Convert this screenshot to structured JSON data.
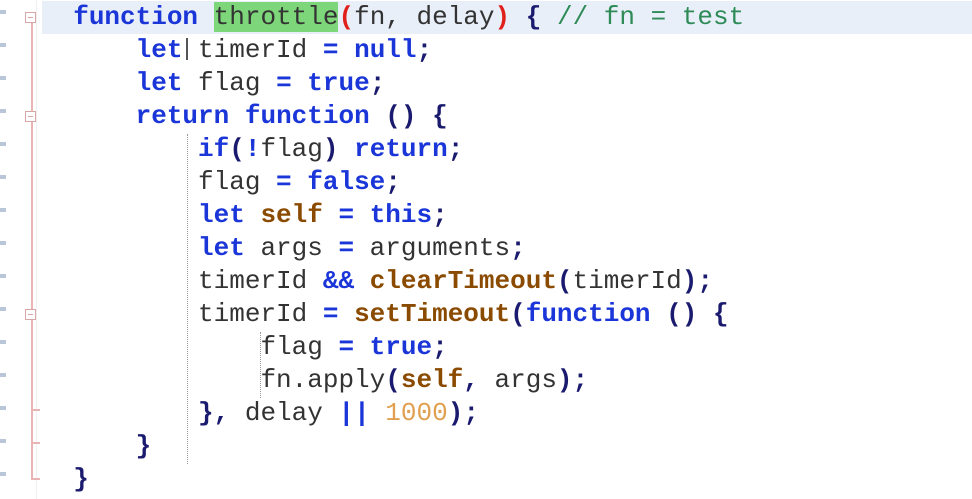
{
  "editor": {
    "lines": [
      {
        "tokens": [
          {
            "t": "function",
            "c": "kw"
          },
          {
            "t": " ",
            "c": "ident"
          },
          {
            "t": "throttle",
            "c": "hl-word"
          },
          {
            "t": "(",
            "c": "paren-hl"
          },
          {
            "t": "fn, delay",
            "c": "ident"
          },
          {
            "t": ")",
            "c": "paren-hl"
          },
          {
            "t": " ",
            "c": "ident"
          },
          {
            "t": "{",
            "c": "punc"
          },
          {
            "t": " // fn = test",
            "c": "comment"
          }
        ],
        "indent": "  ",
        "current": true
      },
      {
        "tokens": [
          {
            "t": "let",
            "c": "kw"
          },
          {
            "t": " timerId ",
            "c": "ident"
          },
          {
            "t": "=",
            "c": "op"
          },
          {
            "t": " ",
            "c": "ident"
          },
          {
            "t": "null",
            "c": "kw"
          },
          {
            "t": ";",
            "c": "punc"
          }
        ],
        "indent": "      "
      },
      {
        "tokens": [
          {
            "t": "let",
            "c": "kw"
          },
          {
            "t": " flag ",
            "c": "ident"
          },
          {
            "t": "=",
            "c": "op"
          },
          {
            "t": " ",
            "c": "ident"
          },
          {
            "t": "true",
            "c": "kw"
          },
          {
            "t": ";",
            "c": "punc"
          }
        ],
        "indent": "      "
      },
      {
        "tokens": [
          {
            "t": "return",
            "c": "kw"
          },
          {
            "t": " ",
            "c": "ident"
          },
          {
            "t": "function",
            "c": "kw"
          },
          {
            "t": " ",
            "c": "ident"
          },
          {
            "t": "()",
            "c": "punc"
          },
          {
            "t": " ",
            "c": "ident"
          },
          {
            "t": "{",
            "c": "punc"
          }
        ],
        "indent": "      "
      },
      {
        "tokens": [
          {
            "t": "if",
            "c": "kw"
          },
          {
            "t": "(",
            "c": "punc"
          },
          {
            "t": "!",
            "c": "op"
          },
          {
            "t": "flag",
            "c": "ident"
          },
          {
            "t": ")",
            "c": "punc"
          },
          {
            "t": " ",
            "c": "ident"
          },
          {
            "t": "return",
            "c": "kw"
          },
          {
            "t": ";",
            "c": "punc"
          }
        ],
        "indent": "          "
      },
      {
        "tokens": [
          {
            "t": "flag ",
            "c": "ident"
          },
          {
            "t": "=",
            "c": "op"
          },
          {
            "t": " ",
            "c": "ident"
          },
          {
            "t": "false",
            "c": "kw"
          },
          {
            "t": ";",
            "c": "punc"
          }
        ],
        "indent": "          "
      },
      {
        "tokens": [
          {
            "t": "let",
            "c": "kw"
          },
          {
            "t": " ",
            "c": "ident"
          },
          {
            "t": "self",
            "c": "fn"
          },
          {
            "t": " ",
            "c": "ident"
          },
          {
            "t": "=",
            "c": "op"
          },
          {
            "t": " ",
            "c": "ident"
          },
          {
            "t": "this",
            "c": "kw"
          },
          {
            "t": ";",
            "c": "punc"
          }
        ],
        "indent": "          "
      },
      {
        "tokens": [
          {
            "t": "let",
            "c": "kw"
          },
          {
            "t": " args ",
            "c": "ident"
          },
          {
            "t": "=",
            "c": "op"
          },
          {
            "t": " arguments",
            "c": "ident"
          },
          {
            "t": ";",
            "c": "punc"
          }
        ],
        "indent": "          "
      },
      {
        "tokens": [
          {
            "t": "timerId ",
            "c": "ident"
          },
          {
            "t": "&&",
            "c": "op"
          },
          {
            "t": " ",
            "c": "ident"
          },
          {
            "t": "clearTimeout",
            "c": "fn"
          },
          {
            "t": "(",
            "c": "punc"
          },
          {
            "t": "timerId",
            "c": "ident"
          },
          {
            "t": ");",
            "c": "punc"
          }
        ],
        "indent": "          "
      },
      {
        "tokens": [
          {
            "t": "timerId ",
            "c": "ident"
          },
          {
            "t": "=",
            "c": "op"
          },
          {
            "t": " ",
            "c": "ident"
          },
          {
            "t": "setTimeout",
            "c": "fn"
          },
          {
            "t": "(",
            "c": "punc"
          },
          {
            "t": "function",
            "c": "kw"
          },
          {
            "t": " ",
            "c": "ident"
          },
          {
            "t": "()",
            "c": "punc"
          },
          {
            "t": " ",
            "c": "ident"
          },
          {
            "t": "{",
            "c": "punc"
          }
        ],
        "indent": "          "
      },
      {
        "tokens": [
          {
            "t": "flag ",
            "c": "ident"
          },
          {
            "t": "=",
            "c": "op"
          },
          {
            "t": " ",
            "c": "ident"
          },
          {
            "t": "true",
            "c": "kw"
          },
          {
            "t": ";",
            "c": "punc"
          }
        ],
        "indent": "              "
      },
      {
        "tokens": [
          {
            "t": "fn.apply",
            "c": "ident"
          },
          {
            "t": "(",
            "c": "punc"
          },
          {
            "t": "self",
            "c": "fn"
          },
          {
            "t": ",",
            "c": "punc"
          },
          {
            "t": " args",
            "c": "ident"
          },
          {
            "t": ");",
            "c": "punc"
          }
        ],
        "indent": "              "
      },
      {
        "tokens": [
          {
            "t": "}",
            "c": "punc"
          },
          {
            "t": ",",
            "c": "punc"
          },
          {
            "t": " delay ",
            "c": "ident"
          },
          {
            "t": "||",
            "c": "op"
          },
          {
            "t": " ",
            "c": "ident"
          },
          {
            "t": "1000",
            "c": "num"
          },
          {
            "t": ");",
            "c": "punc"
          }
        ],
        "indent": "          "
      },
      {
        "tokens": [
          {
            "t": "}",
            "c": "punc"
          }
        ],
        "indent": "      "
      },
      {
        "tokens": [
          {
            "t": "}",
            "c": "punc"
          }
        ],
        "indent": "  "
      }
    ]
  }
}
